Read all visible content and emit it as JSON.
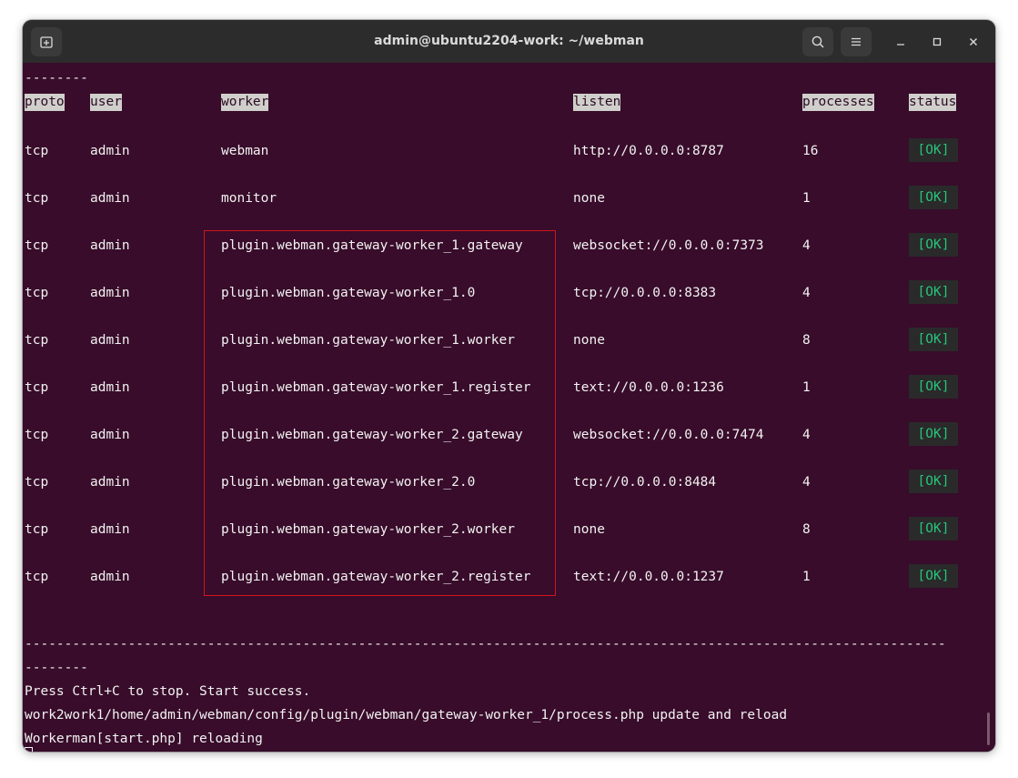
{
  "window": {
    "title": "admin@ubuntu2204-work: ~/webman"
  },
  "titlebar_icons": {
    "new_tab": "new-tab-icon",
    "search": "search-icon",
    "menu": "hamburger-menu-icon",
    "minimize": "minimize-icon",
    "maximize": "maximize-icon",
    "close": "close-icon"
  },
  "terminal": {
    "top_dashes": "--------",
    "headers": {
      "proto": "proto",
      "user": "user",
      "worker": "worker",
      "listen": "listen",
      "processes": "processes",
      "status": "status"
    },
    "rows": [
      {
        "proto": "tcp",
        "user": "admin",
        "worker": "webman",
        "listen": "http://0.0.0.0:8787",
        "processes": "16",
        "status": "[OK]"
      },
      {
        "proto": "tcp",
        "user": "admin",
        "worker": "monitor",
        "listen": "none",
        "processes": "1",
        "status": "[OK]"
      },
      {
        "proto": "tcp",
        "user": "admin",
        "worker": "plugin.webman.gateway-worker_1.gateway",
        "listen": "websocket://0.0.0.0:7373",
        "processes": "4",
        "status": "[OK]"
      },
      {
        "proto": "tcp",
        "user": "admin",
        "worker": "plugin.webman.gateway-worker_1.0",
        "listen": "tcp://0.0.0.0:8383",
        "processes": "4",
        "status": "[OK]"
      },
      {
        "proto": "tcp",
        "user": "admin",
        "worker": "plugin.webman.gateway-worker_1.worker",
        "listen": "none",
        "processes": "8",
        "status": "[OK]"
      },
      {
        "proto": "tcp",
        "user": "admin",
        "worker": "plugin.webman.gateway-worker_1.register",
        "listen": "text://0.0.0.0:1236",
        "processes": "1",
        "status": "[OK]"
      },
      {
        "proto": "tcp",
        "user": "admin",
        "worker": "plugin.webman.gateway-worker_2.gateway",
        "listen": "websocket://0.0.0.0:7474",
        "processes": "4",
        "status": "[OK]"
      },
      {
        "proto": "tcp",
        "user": "admin",
        "worker": "plugin.webman.gateway-worker_2.0",
        "listen": "tcp://0.0.0.0:8484",
        "processes": "4",
        "status": "[OK]"
      },
      {
        "proto": "tcp",
        "user": "admin",
        "worker": "plugin.webman.gateway-worker_2.worker",
        "listen": "none",
        "processes": "8",
        "status": "[OK]"
      },
      {
        "proto": "tcp",
        "user": "admin",
        "worker": "plugin.webman.gateway-worker_2.register",
        "listen": "text://0.0.0.0:1237",
        "processes": "1",
        "status": "[OK]"
      }
    ],
    "separator_long": "--------------------------------------------------------------------------------------------------------------------",
    "separator_short": "--------",
    "output_lines": [
      "Press Ctrl+C to stop. Start success.",
      "work2work1/home/admin/webman/config/plugin/webman/gateway-worker_1/process.php update and reload",
      "Workerman[start.php] reloading"
    ]
  },
  "colors": {
    "terminal_bg": "#380c2a",
    "titlebar_bg": "#2c2c2c",
    "ok_green": "#27c47b",
    "highlight_red": "#d0161b"
  }
}
